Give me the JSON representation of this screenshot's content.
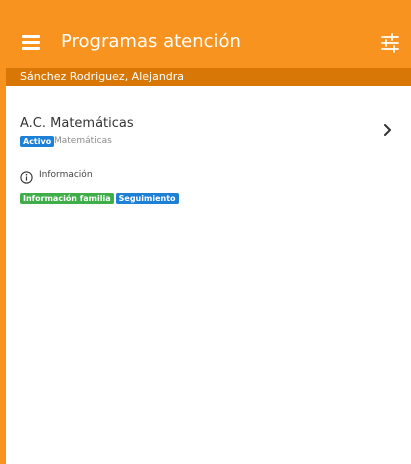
{
  "colors": {
    "appbar": "#f7931e",
    "subheader": "#d97706",
    "badge_blue": "#1e7fd6",
    "badge_green": "#3fae49"
  },
  "appbar": {
    "title": "Programas atención",
    "menu_icon": "menu-icon",
    "filter_icon": "tune-icon"
  },
  "student": {
    "name": "Sánchez Rodriguez, Alejandra"
  },
  "program": {
    "title": "A.C. Matemáticas",
    "status_badge": "Activo",
    "subject": "Matemáticas",
    "chevron_icon": "chevron-right-icon"
  },
  "info": {
    "label": "Información",
    "icon": "info-icon",
    "tags": [
      "Información familia",
      "Seguimiento"
    ]
  }
}
